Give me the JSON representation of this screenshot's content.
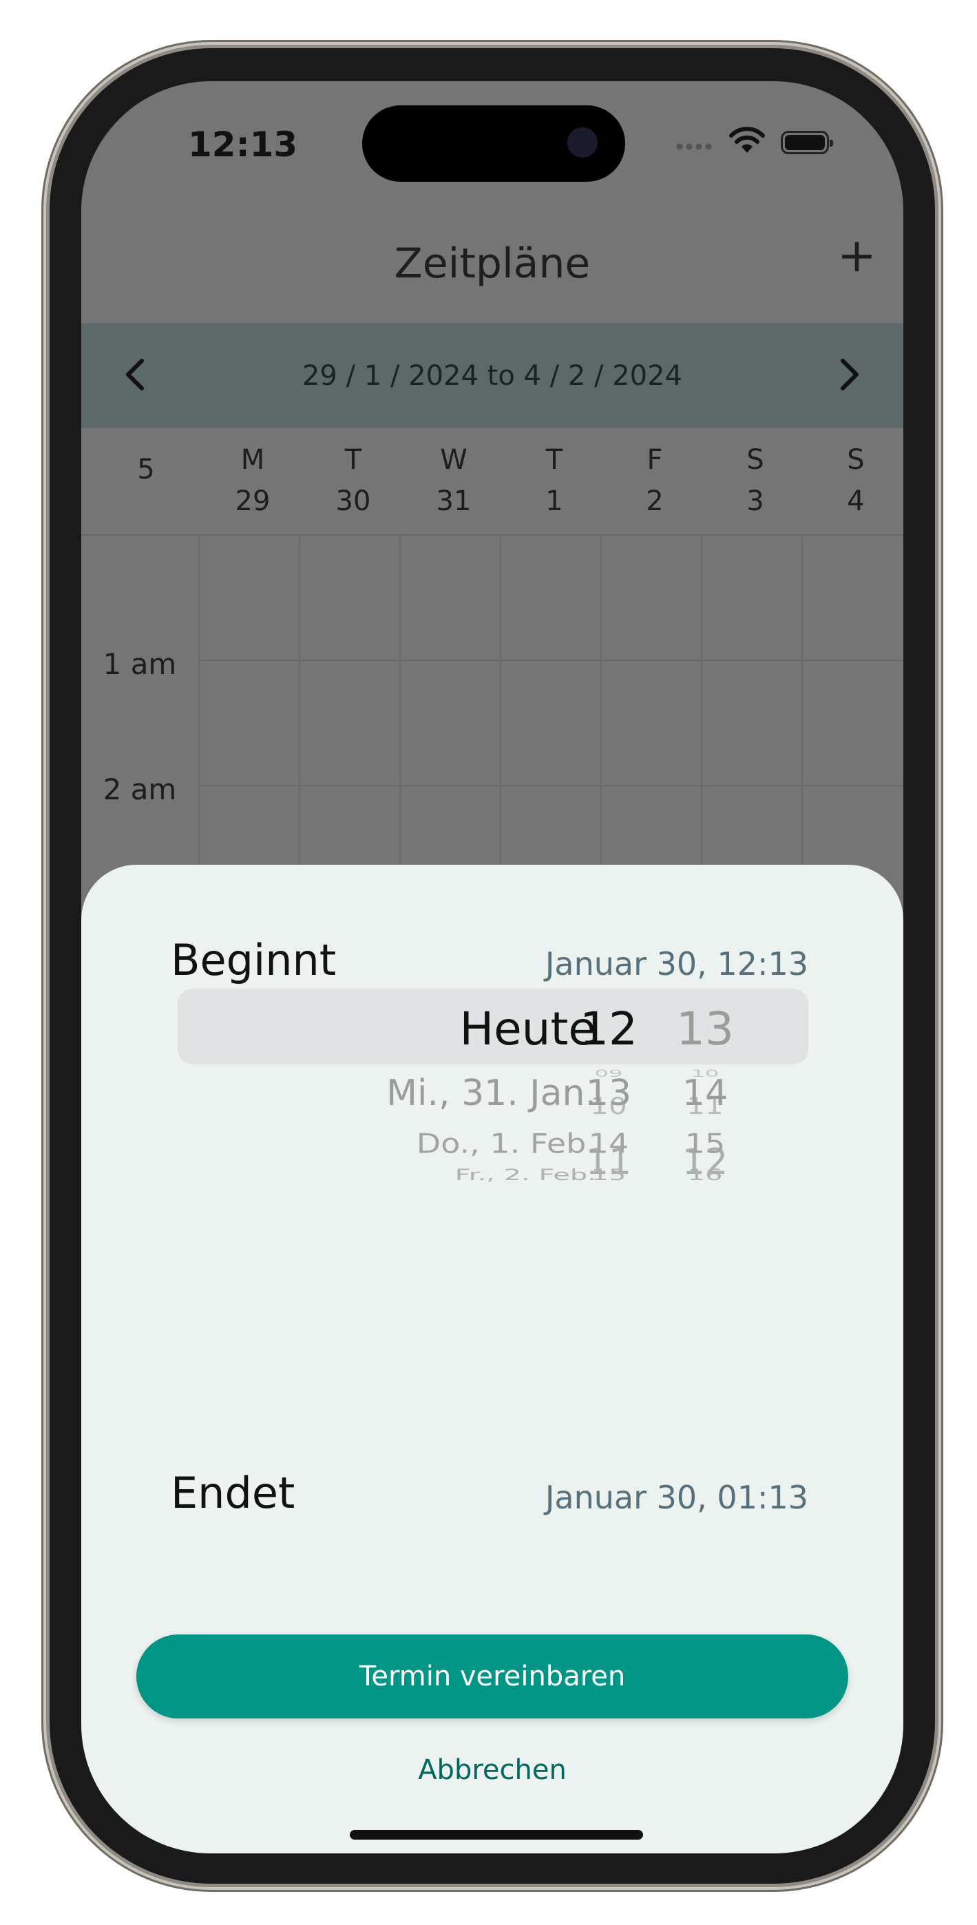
{
  "status_bar": {
    "time": "12:13"
  },
  "header": {
    "title": "Zeitpläne",
    "add_label": "+"
  },
  "week_nav": {
    "prev_label": "‹",
    "next_label": "›",
    "range": "29 / 1 / 2024 to 4 / 2 / 2024"
  },
  "week_number": "5",
  "days": [
    {
      "letter": "M",
      "date": "29"
    },
    {
      "letter": "T",
      "date": "30"
    },
    {
      "letter": "W",
      "date": "31"
    },
    {
      "letter": "T",
      "date": "1"
    },
    {
      "letter": "F",
      "date": "2"
    },
    {
      "letter": "S",
      "date": "3"
    },
    {
      "letter": "S",
      "date": "4"
    }
  ],
  "hours": [
    "1 am",
    "2 am"
  ],
  "sheet": {
    "start_label": "Beginnt",
    "start_value": "Januar 30, 12:13",
    "end_label": "Endet",
    "end_value": "Januar 30, 01:13",
    "picker": {
      "dates": [
        "Heute",
        "Mi., 31. Jan.",
        "Do., 1. Feb.",
        "Fr., 2. Feb."
      ],
      "hours": [
        "09",
        "10",
        "11",
        "12",
        "13",
        "14",
        "15"
      ],
      "minutes": [
        "10",
        "11",
        "12",
        "13",
        "14",
        "15",
        "16"
      ]
    },
    "confirm_label": "Termin vereinbaren",
    "cancel_label": "Abbrechen"
  },
  "colors": {
    "accent": "#009585",
    "nav_band": "#5d6868",
    "sheet_bg": "#ebf2f0",
    "value_text": "#58707c"
  }
}
